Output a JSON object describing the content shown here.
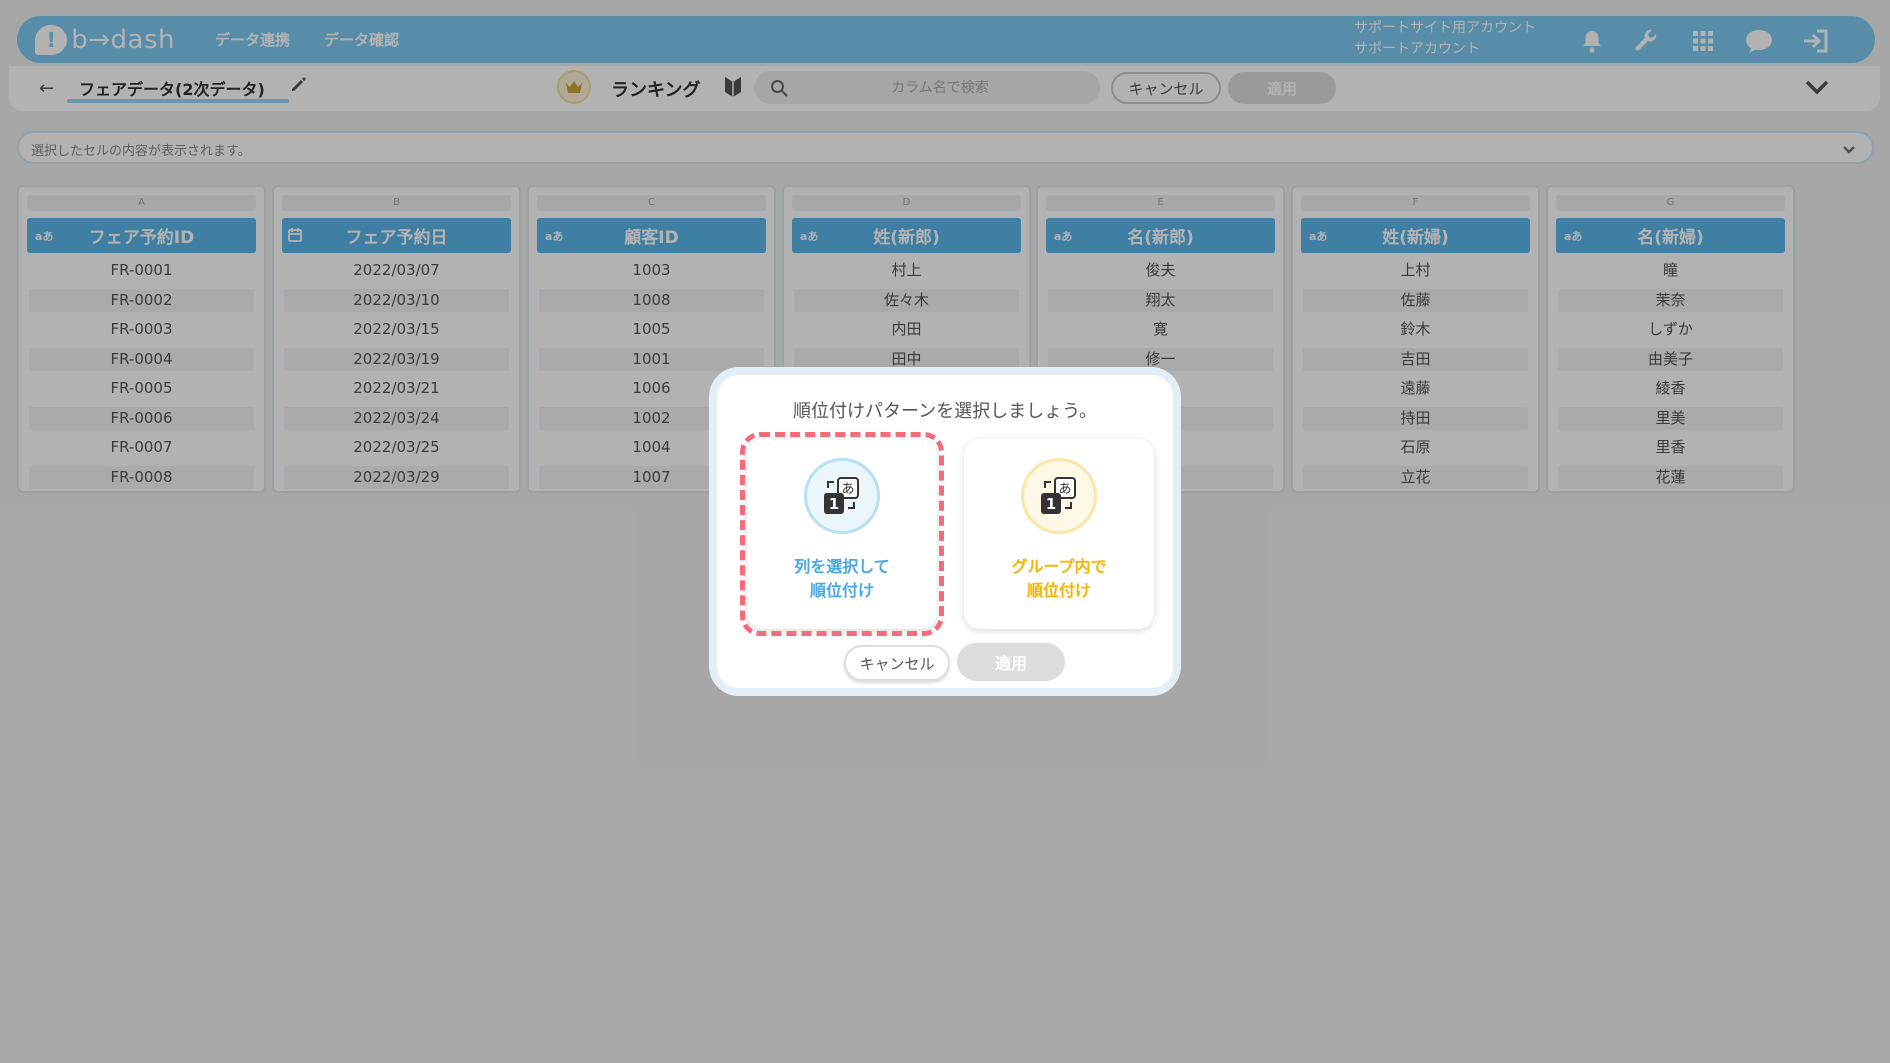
{
  "header": {
    "logo_mark": "!",
    "logo_text": "b→dash",
    "nav": [
      "データ連携",
      "データ確認"
    ],
    "account_line1": "サポートサイト用アカウント",
    "account_line2": "サポートアカウント",
    "icons": [
      "bell-icon",
      "wrench-icon",
      "grid-apps-icon",
      "chat-icon",
      "logout-icon"
    ]
  },
  "toolbar": {
    "back": "←",
    "dataset_title": "フェアデータ(2次データ)",
    "ranking_label": "ランキング",
    "search_placeholder": "カラム名で検索",
    "cancel_label": "キャンセル",
    "apply_label": "適用"
  },
  "cell_bar": {
    "text": "選択したセルの内容が表示されます。"
  },
  "table": {
    "columns": [
      {
        "letter": "A",
        "type": "aあ",
        "header": "フェア予約ID",
        "cells": [
          "FR-0001",
          "FR-0002",
          "FR-0003",
          "FR-0004",
          "FR-0005",
          "FR-0006",
          "FR-0007",
          "FR-0008"
        ]
      },
      {
        "letter": "B",
        "type": "calendar",
        "header": "フェア予約日",
        "cells": [
          "2022/03/07",
          "2022/03/10",
          "2022/03/15",
          "2022/03/19",
          "2022/03/21",
          "2022/03/24",
          "2022/03/25",
          "2022/03/29"
        ]
      },
      {
        "letter": "C",
        "type": "aあ",
        "header": "顧客ID",
        "cells": [
          "1003",
          "1008",
          "1005",
          "1001",
          "1006",
          "1002",
          "1004",
          "1007"
        ]
      },
      {
        "letter": "D",
        "type": "aあ",
        "header": "姓(新郎)",
        "cells": [
          "村上",
          "佐々木",
          "内田",
          "田中",
          "",
          "",
          "",
          ""
        ]
      },
      {
        "letter": "E",
        "type": "aあ",
        "header": "名(新郎)",
        "cells": [
          "俊夫",
          "翔太",
          "寛",
          "修一",
          "",
          "",
          "",
          ""
        ]
      },
      {
        "letter": "F",
        "type": "aあ",
        "header": "姓(新婦)",
        "cells": [
          "上村",
          "佐藤",
          "鈴木",
          "吉田",
          "遠藤",
          "持田",
          "石原",
          "立花"
        ]
      },
      {
        "letter": "G",
        "type": "aあ",
        "header": "名(新婦)",
        "cells": [
          "瞳",
          "茉奈",
          "しずか",
          "由美子",
          "綾香",
          "里美",
          "里香",
          "花蓮"
        ]
      }
    ]
  },
  "modal": {
    "title": "順位付けパターンを選択しましょう。",
    "option1_line1": "列を選択して",
    "option1_line2": "順位付け",
    "option2_line1": "グループ内で",
    "option2_line2": "順位付け",
    "cancel_label": "キャンセル",
    "apply_label": "適用"
  },
  "colors": {
    "header_blue": "#7ecbf2",
    "column_header_blue": "#5bb6ea",
    "option1_text": "#4aa8e6",
    "option2_text": "#f5b400",
    "highlight_red": "#f46b79"
  }
}
